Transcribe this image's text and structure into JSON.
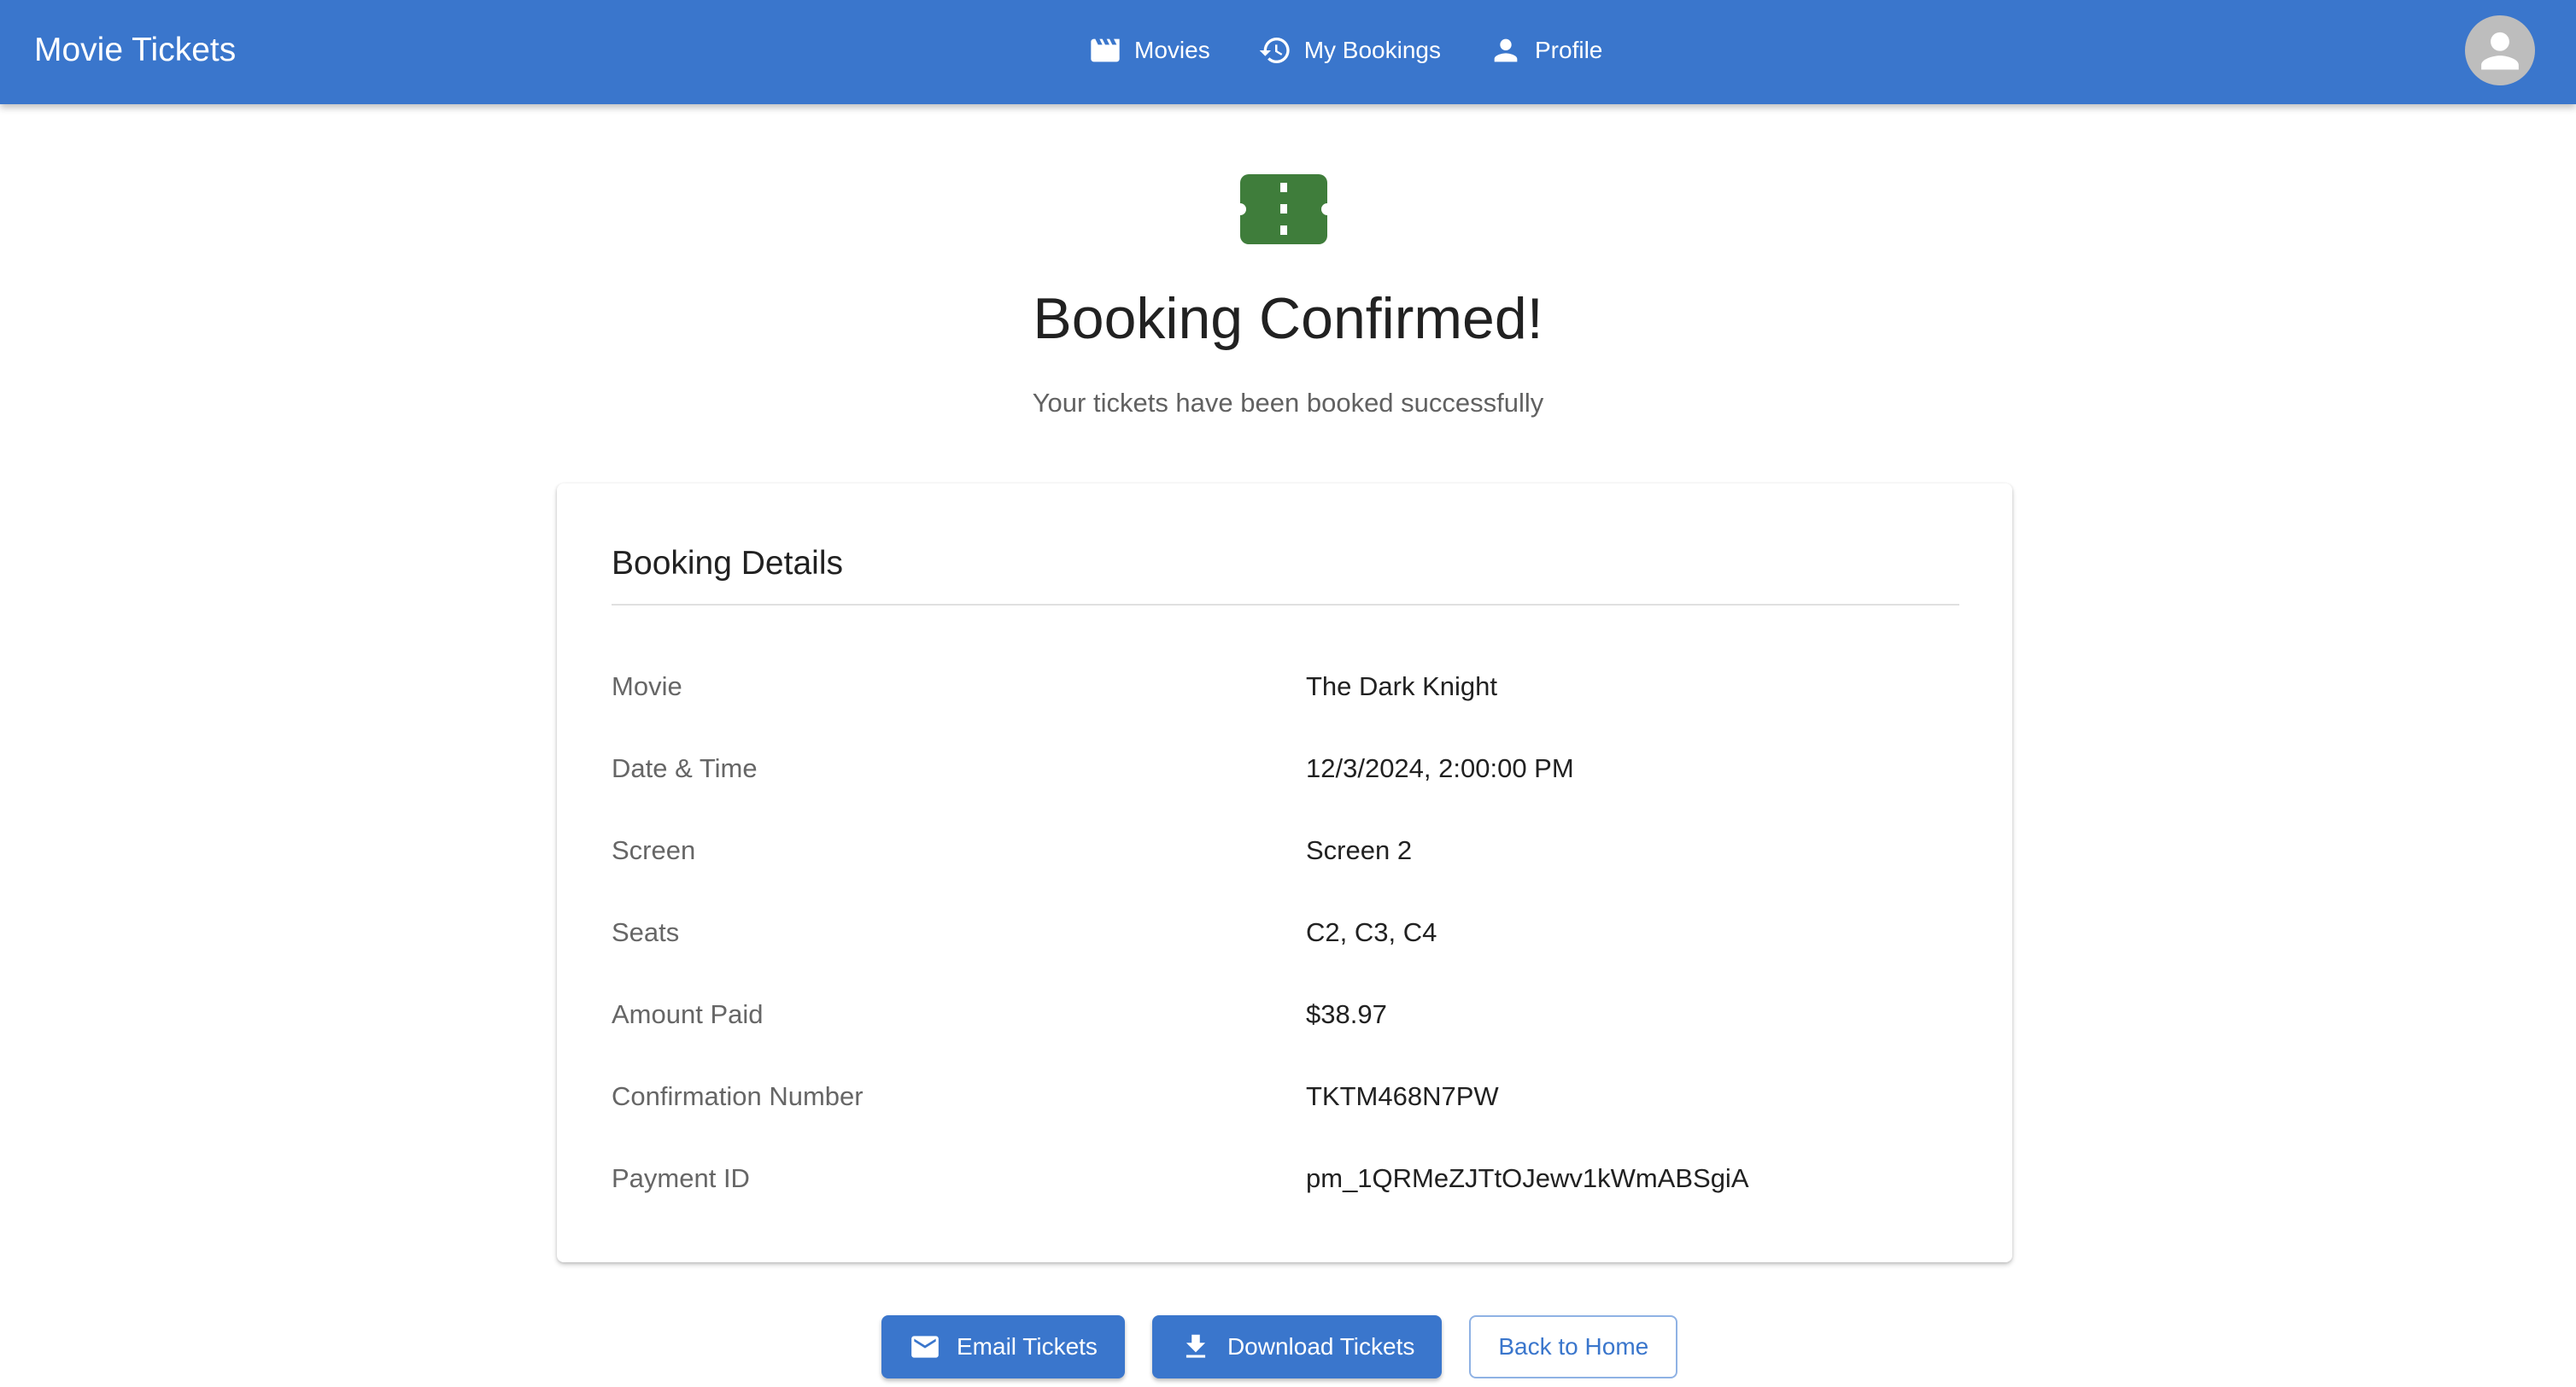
{
  "appbar": {
    "title": "Movie Tickets",
    "nav": [
      {
        "label": "Movies",
        "icon": "movie-icon"
      },
      {
        "label": "My Bookings",
        "icon": "history-icon"
      },
      {
        "label": "Profile",
        "icon": "person-icon"
      }
    ],
    "avatar_icon": "account-avatar-icon"
  },
  "hero": {
    "icon": "ticket-icon",
    "title": "Booking Confirmed!",
    "subtitle": "Your tickets have been booked successfully"
  },
  "details": {
    "title": "Booking Details",
    "rows": [
      {
        "label": "Movie",
        "value": "The Dark Knight"
      },
      {
        "label": "Date & Time",
        "value": "12/3/2024, 2:00:00 PM"
      },
      {
        "label": "Screen",
        "value": "Screen 2"
      },
      {
        "label": "Seats",
        "value": "C2, C3, C4"
      },
      {
        "label": "Amount Paid",
        "value": "$38.97"
      },
      {
        "label": "Confirmation Number",
        "value": "TKTM468N7PW"
      },
      {
        "label": "Payment ID",
        "value": "pm_1QRMeZJTtOJewv1kWmABSgiA"
      }
    ]
  },
  "actions": {
    "email_label": "Email Tickets",
    "download_label": "Download Tickets",
    "home_label": "Back to Home"
  },
  "colors": {
    "primary": "#3a76cc",
    "success": "#3f7d3b",
    "label_text": "#666666"
  }
}
